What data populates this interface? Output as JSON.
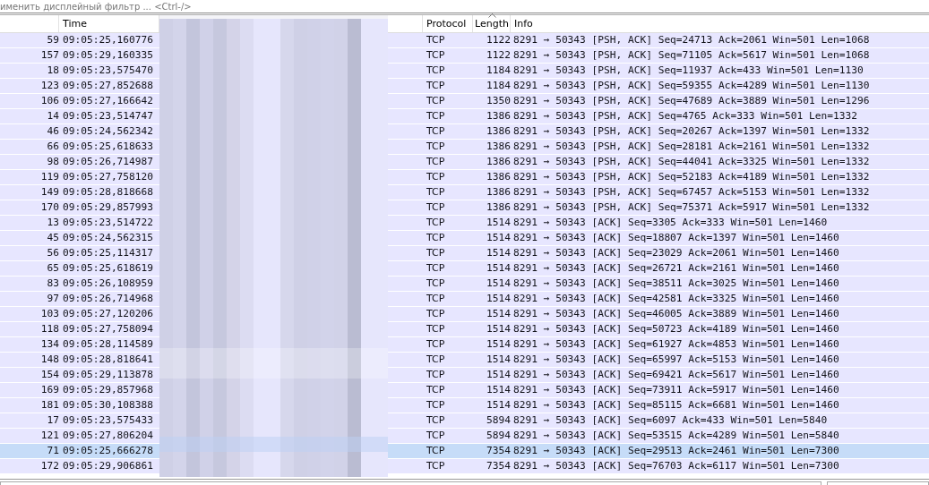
{
  "filter_bar": {
    "placeholder": "именить дисплейный фильтр ... <Ctrl-/>"
  },
  "columns": [
    {
      "label": "Time",
      "sorted": false
    },
    {
      "label": "Protocol",
      "sorted": false
    },
    {
      "label": "Length",
      "sorted": true
    },
    {
      "label": "Info",
      "sorted": false
    }
  ],
  "rows": [
    {
      "no": "59",
      "time": "09:05:25,160776",
      "protocol": "TCP",
      "length": "1122",
      "info": "8291 → 50343 [PSH, ACK] Seq=24713 Ack=2061 Win=501 Len=1068",
      "selected": false
    },
    {
      "no": "157",
      "time": "09:05:29,160335",
      "protocol": "TCP",
      "length": "1122",
      "info": "8291 → 50343 [PSH, ACK] Seq=71105 Ack=5617 Win=501 Len=1068",
      "selected": false
    },
    {
      "no": "18",
      "time": "09:05:23,575470",
      "protocol": "TCP",
      "length": "1184",
      "info": "8291 → 50343 [PSH, ACK] Seq=11937 Ack=433 Win=501 Len=1130",
      "selected": false
    },
    {
      "no": "123",
      "time": "09:05:27,852688",
      "protocol": "TCP",
      "length": "1184",
      "info": "8291 → 50343 [PSH, ACK] Seq=59355 Ack=4289 Win=501 Len=1130",
      "selected": false
    },
    {
      "no": "106",
      "time": "09:05:27,166642",
      "protocol": "TCP",
      "length": "1350",
      "info": "8291 → 50343 [PSH, ACK] Seq=47689 Ack=3889 Win=501 Len=1296",
      "selected": false
    },
    {
      "no": "14",
      "time": "09:05:23,514747",
      "protocol": "TCP",
      "length": "1386",
      "info": "8291 → 50343 [PSH, ACK] Seq=4765 Ack=333 Win=501 Len=1332",
      "selected": false
    },
    {
      "no": "46",
      "time": "09:05:24,562342",
      "protocol": "TCP",
      "length": "1386",
      "info": "8291 → 50343 [PSH, ACK] Seq=20267 Ack=1397 Win=501 Len=1332",
      "selected": false
    },
    {
      "no": "66",
      "time": "09:05:25,618633",
      "protocol": "TCP",
      "length": "1386",
      "info": "8291 → 50343 [PSH, ACK] Seq=28181 Ack=2161 Win=501 Len=1332",
      "selected": false
    },
    {
      "no": "98",
      "time": "09:05:26,714987",
      "protocol": "TCP",
      "length": "1386",
      "info": "8291 → 50343 [PSH, ACK] Seq=44041 Ack=3325 Win=501 Len=1332",
      "selected": false
    },
    {
      "no": "119",
      "time": "09:05:27,758120",
      "protocol": "TCP",
      "length": "1386",
      "info": "8291 → 50343 [PSH, ACK] Seq=52183 Ack=4189 Win=501 Len=1332",
      "selected": false
    },
    {
      "no": "149",
      "time": "09:05:28,818668",
      "protocol": "TCP",
      "length": "1386",
      "info": "8291 → 50343 [PSH, ACK] Seq=67457 Ack=5153 Win=501 Len=1332",
      "selected": false
    },
    {
      "no": "170",
      "time": "09:05:29,857993",
      "protocol": "TCP",
      "length": "1386",
      "info": "8291 → 50343 [PSH, ACK] Seq=75371 Ack=5917 Win=501 Len=1332",
      "selected": false
    },
    {
      "no": "13",
      "time": "09:05:23,514722",
      "protocol": "TCP",
      "length": "1514",
      "info": "8291 → 50343 [ACK] Seq=3305 Ack=333 Win=501 Len=1460",
      "selected": false
    },
    {
      "no": "45",
      "time": "09:05:24,562315",
      "protocol": "TCP",
      "length": "1514",
      "info": "8291 → 50343 [ACK] Seq=18807 Ack=1397 Win=501 Len=1460",
      "selected": false
    },
    {
      "no": "56",
      "time": "09:05:25,114317",
      "protocol": "TCP",
      "length": "1514",
      "info": "8291 → 50343 [ACK] Seq=23029 Ack=2061 Win=501 Len=1460",
      "selected": false
    },
    {
      "no": "65",
      "time": "09:05:25,618619",
      "protocol": "TCP",
      "length": "1514",
      "info": "8291 → 50343 [ACK] Seq=26721 Ack=2161 Win=501 Len=1460",
      "selected": false
    },
    {
      "no": "83",
      "time": "09:05:26,108959",
      "protocol": "TCP",
      "length": "1514",
      "info": "8291 → 50343 [ACK] Seq=38511 Ack=3025 Win=501 Len=1460",
      "selected": false
    },
    {
      "no": "97",
      "time": "09:05:26,714968",
      "protocol": "TCP",
      "length": "1514",
      "info": "8291 → 50343 [ACK] Seq=42581 Ack=3325 Win=501 Len=1460",
      "selected": false
    },
    {
      "no": "103",
      "time": "09:05:27,120206",
      "protocol": "TCP",
      "length": "1514",
      "info": "8291 → 50343 [ACK] Seq=46005 Ack=3889 Win=501 Len=1460",
      "selected": false
    },
    {
      "no": "118",
      "time": "09:05:27,758094",
      "protocol": "TCP",
      "length": "1514",
      "info": "8291 → 50343 [ACK] Seq=50723 Ack=4189 Win=501 Len=1460",
      "selected": false
    },
    {
      "no": "134",
      "time": "09:05:28,114589",
      "protocol": "TCP",
      "length": "1514",
      "info": "8291 → 50343 [ACK] Seq=61927 Ack=4853 Win=501 Len=1460",
      "selected": false
    },
    {
      "no": "148",
      "time": "09:05:28,818641",
      "protocol": "TCP",
      "length": "1514",
      "info": "8291 → 50343 [ACK] Seq=65997 Ack=5153 Win=501 Len=1460",
      "selected": false
    },
    {
      "no": "154",
      "time": "09:05:29,113878",
      "protocol": "TCP",
      "length": "1514",
      "info": "8291 → 50343 [ACK] Seq=69421 Ack=5617 Win=501 Len=1460",
      "selected": false
    },
    {
      "no": "169",
      "time": "09:05:29,857968",
      "protocol": "TCP",
      "length": "1514",
      "info": "8291 → 50343 [ACK] Seq=73911 Ack=5917 Win=501 Len=1460",
      "selected": false
    },
    {
      "no": "181",
      "time": "09:05:30,108388",
      "protocol": "TCP",
      "length": "1514",
      "info": "8291 → 50343 [ACK] Seq=85115 Ack=6681 Win=501 Len=1460",
      "selected": false
    },
    {
      "no": "17",
      "time": "09:05:23,575433",
      "protocol": "TCP",
      "length": "5894",
      "info": "8291 → 50343 [ACK] Seq=6097 Ack=433 Win=501 Len=5840",
      "selected": false
    },
    {
      "no": "121",
      "time": "09:05:27,806204",
      "protocol": "TCP",
      "length": "5894",
      "info": "8291 → 50343 [ACK] Seq=53515 Ack=4289 Win=501 Len=5840",
      "selected": false
    },
    {
      "no": "71",
      "time": "09:05:25,666278",
      "protocol": "TCP",
      "length": "7354",
      "info": "8291 → 50343 [ACK] Seq=29513 Ack=2461 Win=501 Len=7300",
      "selected": true
    },
    {
      "no": "172",
      "time": "09:05:29,906861",
      "protocol": "TCP",
      "length": "7354",
      "info": "8291 → 50343 [ACK] Seq=76703 Ack=6117 Win=501 Len=7300",
      "selected": false
    }
  ]
}
